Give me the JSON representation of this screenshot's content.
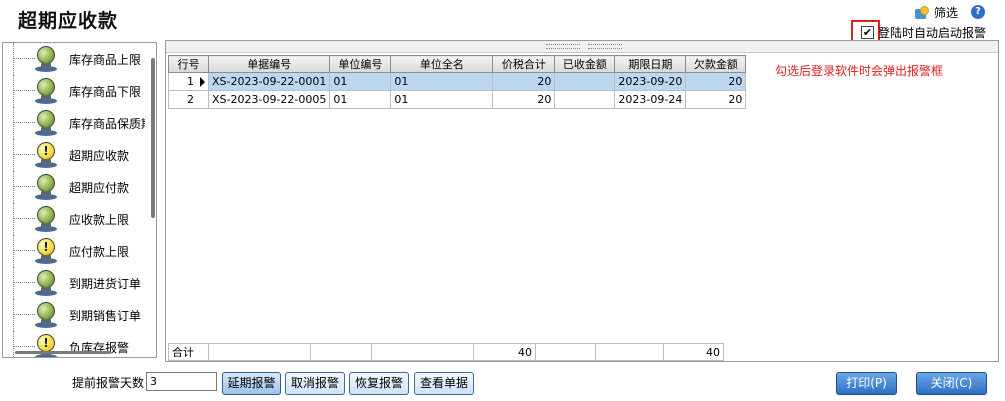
{
  "title": "超期应收款",
  "toolbar": {
    "filter_label": "筛选",
    "help_glyph": "?"
  },
  "auto_alarm": {
    "label": "登陆时自动启动报警",
    "checked": true,
    "check_glyph": "✔"
  },
  "hint": "勾选后登录软件时会弹出报警框",
  "tree": {
    "items": [
      {
        "label": "库存商品上限",
        "icon": "green-bulb-icon"
      },
      {
        "label": "库存商品下限",
        "icon": "green-bulb-icon"
      },
      {
        "label": "库存商品保质期",
        "icon": "green-bulb-icon"
      },
      {
        "label": "超期应收款",
        "icon": "yellow-alert-bulb-icon"
      },
      {
        "label": "超期应付款",
        "icon": "green-bulb-icon"
      },
      {
        "label": "应收款上限",
        "icon": "green-bulb-icon"
      },
      {
        "label": "应付款上限",
        "icon": "yellow-alert-bulb-icon"
      },
      {
        "label": "到期进货订单",
        "icon": "green-bulb-icon"
      },
      {
        "label": "到期销售订单",
        "icon": "green-bulb-icon"
      },
      {
        "label": "负库存报警",
        "icon": "yellow-alert-bulb-icon"
      }
    ]
  },
  "grid": {
    "columns": [
      "行号",
      "单据编号",
      "单位编号",
      "单位全名",
      "价税合计",
      "已收金额",
      "期限日期",
      "欠款金额"
    ],
    "rows": [
      {
        "rowno": "1",
        "bill_no": "XS-2023-09-22-0001",
        "unit_code": "01",
        "unit_name": "01",
        "tax_total": "20",
        "received": "",
        "due_date": "2023-09-20",
        "owed": "20",
        "selected": true
      },
      {
        "rowno": "2",
        "bill_no": "XS-2023-09-22-0005",
        "unit_code": "01",
        "unit_name": "01",
        "tax_total": "20",
        "received": "",
        "due_date": "2023-09-24",
        "owed": "20",
        "selected": false
      }
    ],
    "total": {
      "label": "合计",
      "tax_total": "40",
      "owed": "40"
    }
  },
  "bottom": {
    "days_label": "提前报警天数",
    "days_value": "3",
    "buttons": {
      "delay": "延期报警",
      "cancel": "取消报警",
      "restore": "恢复报警",
      "view": "查看单据",
      "print": "打印(P)",
      "close": "关闭(C)"
    }
  }
}
